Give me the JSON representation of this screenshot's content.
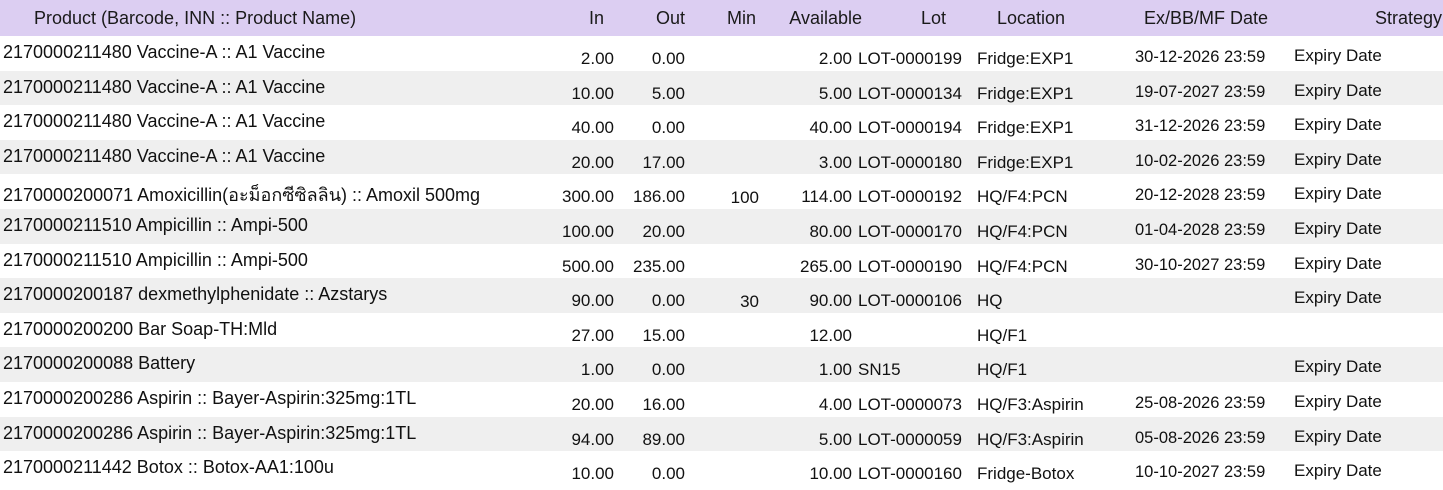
{
  "headers": {
    "product": "Product (Barcode, INN :: Product Name)",
    "in": "In",
    "out": "Out",
    "min": "Min",
    "available": "Available",
    "lot": "Lot",
    "location": "Location",
    "date": "Ex/BB/MF Date",
    "strategy": "Strategy"
  },
  "rows": [
    {
      "product": "2170000211480 Vaccine-A :: A1 Vaccine",
      "in": "2.00",
      "out": "0.00",
      "min": "",
      "available": "2.00",
      "lot": "LOT-0000199",
      "location": "Fridge:EXP1",
      "date": "30-12-2026 23:59",
      "strategy": "Expiry Date"
    },
    {
      "product": "2170000211480 Vaccine-A :: A1 Vaccine",
      "in": "10.00",
      "out": "5.00",
      "min": "",
      "available": "5.00",
      "lot": "LOT-0000134",
      "location": "Fridge:EXP1",
      "date": "19-07-2027 23:59",
      "strategy": "Expiry Date"
    },
    {
      "product": "2170000211480 Vaccine-A :: A1 Vaccine",
      "in": "40.00",
      "out": "0.00",
      "min": "",
      "available": "40.00",
      "lot": "LOT-0000194",
      "location": "Fridge:EXP1",
      "date": "31-12-2026 23:59",
      "strategy": "Expiry Date"
    },
    {
      "product": "2170000211480 Vaccine-A :: A1 Vaccine",
      "in": "20.00",
      "out": "17.00",
      "min": "",
      "available": "3.00",
      "lot": "LOT-0000180",
      "location": "Fridge:EXP1",
      "date": "10-02-2026 23:59",
      "strategy": "Expiry Date"
    },
    {
      "product": "2170000200071 Amoxicillin(อะม็อกซีซิลลิน) :: Amoxil 500mg",
      "in": "300.00",
      "out": "186.00",
      "min": "100",
      "available": "114.00",
      "lot": "LOT-0000192",
      "location": "HQ/F4:PCN",
      "date": "20-12-2028 23:59",
      "strategy": "Expiry Date"
    },
    {
      "product": "2170000211510 Ampicillin :: Ampi-500",
      "in": "100.00",
      "out": "20.00",
      "min": "",
      "available": "80.00",
      "lot": "LOT-0000170",
      "location": "HQ/F4:PCN",
      "date": "01-04-2028 23:59",
      "strategy": "Expiry Date"
    },
    {
      "product": "2170000211510 Ampicillin :: Ampi-500",
      "in": "500.00",
      "out": "235.00",
      "min": "",
      "available": "265.00",
      "lot": "LOT-0000190",
      "location": "HQ/F4:PCN",
      "date": "30-10-2027 23:59",
      "strategy": "Expiry Date"
    },
    {
      "product": "2170000200187 dexmethylphenidate :: Azstarys",
      "in": "90.00",
      "out": "0.00",
      "min": "30",
      "available": "90.00",
      "lot": "LOT-0000106",
      "location": "HQ",
      "date": "",
      "strategy": "Expiry Date"
    },
    {
      "product": "2170000200200 Bar Soap-TH:Mld",
      "in": "27.00",
      "out": "15.00",
      "min": "",
      "available": "12.00",
      "lot": "",
      "location": "HQ/F1",
      "date": "",
      "strategy": ""
    },
    {
      "product": "2170000200088 Battery",
      "in": "1.00",
      "out": "0.00",
      "min": "",
      "available": "1.00",
      "lot": "SN15",
      "location": "HQ/F1",
      "date": "",
      "strategy": "Expiry Date"
    },
    {
      "product": "2170000200286 Aspirin :: Bayer-Aspirin:325mg:1TL",
      "in": "20.00",
      "out": "16.00",
      "min": "",
      "available": "4.00",
      "lot": "LOT-0000073",
      "location": "HQ/F3:Aspirin",
      "date": "25-08-2026 23:59",
      "strategy": "Expiry Date"
    },
    {
      "product": "2170000200286 Aspirin :: Bayer-Aspirin:325mg:1TL",
      "in": "94.00",
      "out": "89.00",
      "min": "",
      "available": "5.00",
      "lot": "LOT-0000059",
      "location": "HQ/F3:Aspirin",
      "date": "05-08-2026 23:59",
      "strategy": "Expiry Date"
    },
    {
      "product": "2170000211442 Botox :: Botox-AA1:100u",
      "in": "10.00",
      "out": "0.00",
      "min": "",
      "available": "10.00",
      "lot": "LOT-0000160",
      "location": "Fridge-Botox",
      "date": "10-10-2027 23:59",
      "strategy": "Expiry Date"
    }
  ],
  "colors": {
    "header_bg": "#dccef2",
    "stripe_bg": "#efefef"
  }
}
